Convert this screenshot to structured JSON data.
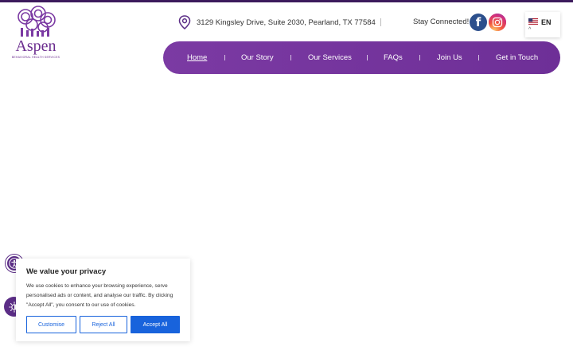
{
  "brand": {
    "name": "Aspen",
    "tagline": "BEHAVIORAL HEALTH SERVICES",
    "accent_color": "#7b3aa3"
  },
  "header": {
    "address": "3129 Kingsley Drive, Suite 2030, Pearland, TX 77584",
    "stay_connected": "Stay Connected!",
    "social": {
      "facebook_glyph": "f",
      "facebook_icon": "facebook-icon",
      "instagram_icon": "instagram-icon"
    },
    "language": {
      "code": "EN",
      "caret": "^"
    }
  },
  "nav": {
    "items": [
      {
        "label": "Home",
        "active": true
      },
      {
        "label": "Our Story"
      },
      {
        "label": "Our Services"
      },
      {
        "label": "FAQs"
      },
      {
        "label": "Join Us"
      },
      {
        "label": "Get in Touch"
      }
    ]
  },
  "cookie": {
    "title": "We value your privacy",
    "body": "We use cookies to enhance your browsing experience, serve personalised ads or content, and analyse our traffic. By clicking \"Accept All\", you consent to our use of cookies.",
    "customise": "Customise",
    "reject": "Reject All",
    "accept": "Accept All",
    "button_color": "#1863dc"
  },
  "accessibility": {
    "icons": [
      "accessibility-person-icon",
      "contrast-sun-icon"
    ]
  }
}
